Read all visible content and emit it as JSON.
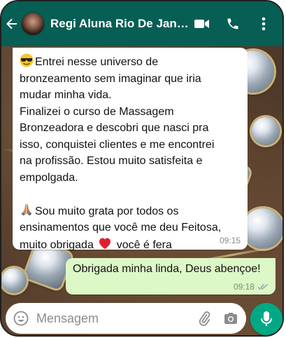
{
  "header": {
    "contact_name": "Regi Aluna Rio De Jane…",
    "icons": [
      "back-arrow-icon",
      "video-call-icon",
      "phone-call-icon",
      "more-options-icon"
    ]
  },
  "messages": [
    {
      "direction": "incoming",
      "paragraphs": [
        {
          "emoji": "smiling-face-with-sunglasses",
          "lines": [
            "Entrei nesse universo de",
            "bronzeamento sem imaginar que iria",
            "mudar minha vida."
          ]
        },
        {
          "emoji": null,
          "lines": [
            "Finalizei o curso de Massagem",
            "Bronzeadora e descobri que nasci pra",
            "isso, conquistei clientes e me encontrei",
            "na profissão. Estou muito satisfeita e",
            "empolgada."
          ]
        },
        {
          "emoji": "folded-hands",
          "lines": [
            "Sou muito grata por todos os",
            "ensinamentos que você me deu Feitosa,"
          ]
        }
      ],
      "last_line_before_heart": "muito obrigada",
      "last_line_after_heart": "você é fera",
      "time": "09:15"
    },
    {
      "direction": "outgoing",
      "text": "Obrigada minha linda, Deus abençoe!",
      "time": "09:18",
      "status": "read"
    }
  ],
  "composer": {
    "placeholder": "Mensagem",
    "icons": [
      "emoji-icon",
      "attach-icon",
      "camera-icon",
      "mic-icon"
    ]
  },
  "colors": {
    "header": "#075e54",
    "outgoing_bubble": "#dcf8c6",
    "mic_button": "#00a884",
    "heart": "#e0202e"
  }
}
